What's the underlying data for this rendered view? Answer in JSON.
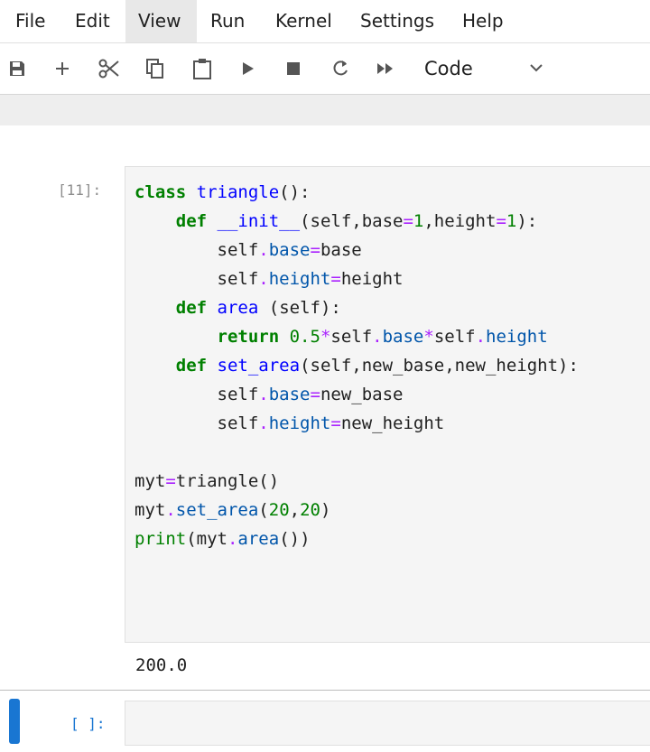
{
  "menu": {
    "items": [
      {
        "label": "File"
      },
      {
        "label": "Edit"
      },
      {
        "label": "View"
      },
      {
        "label": "Run"
      },
      {
        "label": "Kernel"
      },
      {
        "label": "Settings"
      },
      {
        "label": "Help"
      }
    ],
    "active": "View"
  },
  "toolbar": {
    "icons": [
      "save-icon",
      "add-icon",
      "cut-icon",
      "copy-icon",
      "paste-icon",
      "run-icon",
      "stop-icon",
      "restart-icon",
      "fast-forward-icon"
    ],
    "cell_type": "Code"
  },
  "cell1": {
    "prompt": "[11]:",
    "output": "200.0"
  },
  "cell2": {
    "prompt": "[ ]:"
  },
  "colors": {
    "keyword": "#008000",
    "name": "#0000ff",
    "operator": "#aa22ff",
    "attribute": "#0055aa",
    "active_cell": "#1976d2"
  }
}
